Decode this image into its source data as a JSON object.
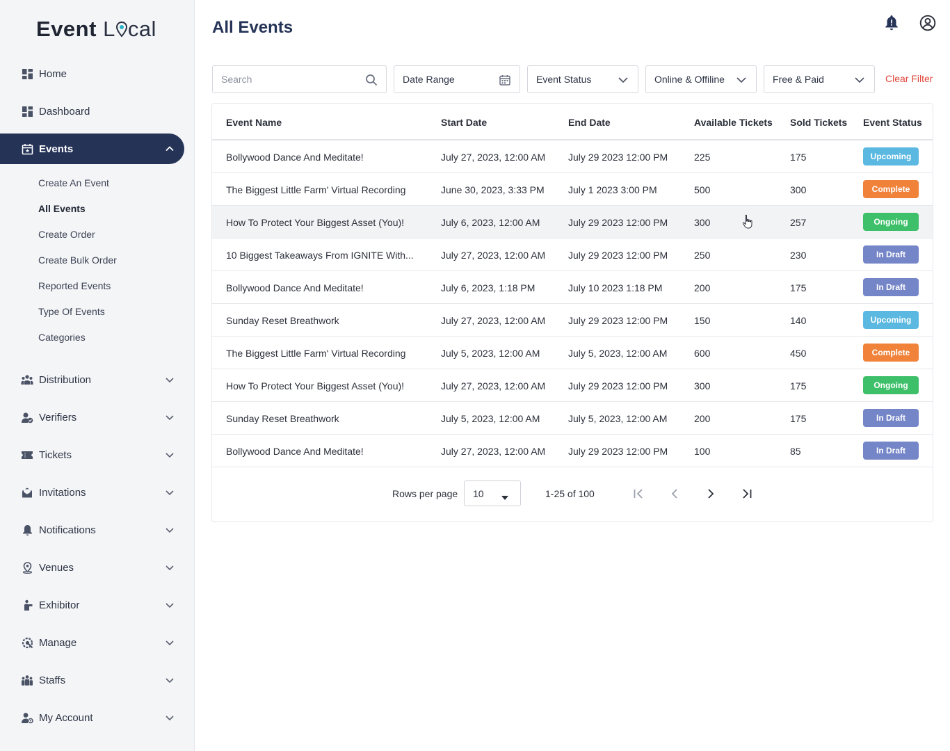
{
  "brand": {
    "part1": "E",
    "part2": "vent",
    "part3": "L",
    "part4": "cal"
  },
  "colors": {
    "accent": "#253357",
    "upcoming": "#5bb8e0",
    "complete": "#f0823a",
    "ongoing": "#3ec06a",
    "in_draft": "#7485c8",
    "danger": "#e0453a"
  },
  "sidebar": {
    "items": [
      {
        "label": "Home",
        "icon": "grid-icon"
      },
      {
        "label": "Dashboard",
        "icon": "grid-icon"
      },
      {
        "label": "Events",
        "icon": "calendar-icon"
      },
      {
        "label": "Distribution",
        "icon": "people-icon"
      },
      {
        "label": "Verifiers",
        "icon": "user-check-icon"
      },
      {
        "label": "Tickets",
        "icon": "ticket-icon"
      },
      {
        "label": "Invitations",
        "icon": "mail-icon"
      },
      {
        "label": "Notifications",
        "icon": "bell-icon"
      },
      {
        "label": "Venues",
        "icon": "location-icon"
      },
      {
        "label": "Exhibitor",
        "icon": "exhibitor-icon"
      },
      {
        "label": "Manage",
        "icon": "manage-icon"
      },
      {
        "label": "Staffs",
        "icon": "staff-icon"
      },
      {
        "label": "My Account",
        "icon": "account-icon"
      }
    ],
    "events_sub": [
      "Create An Event",
      "All Events",
      "Create Order",
      "Create Bulk Order",
      "Reported Events",
      "Type Of Events",
      "Categories"
    ]
  },
  "header": {
    "title": "All Events"
  },
  "filters": {
    "search_placeholder": "Search",
    "date_range": "Date Range",
    "event_status": "Event Status",
    "online_offline": "Online & Offiline",
    "free_paid": "Free & Paid",
    "clear": "Clear Filter"
  },
  "table": {
    "headers": [
      "Event Name",
      "Start Date",
      "End Date",
      "Available Tickets",
      "Sold Tickets",
      "Event Status"
    ],
    "rows": [
      {
        "name": "Bollywood Dance And Meditate!",
        "start": "July 27, 2023, 12:00 AM",
        "end": "July 29 2023 12:00 PM",
        "available": "225",
        "sold": "175",
        "status": "Upcoming",
        "status_key": "upcoming"
      },
      {
        "name": "The Biggest Little Farm' Virtual Recording",
        "start": "June 30, 2023, 3:33 PM",
        "end": "July 1 2023 3:00 PM",
        "available": "500",
        "sold": "300",
        "status": "Complete",
        "status_key": "complete"
      },
      {
        "name": "How To Protect Your Biggest Asset (You)!",
        "start": "July 6, 2023, 12:00 AM",
        "end": "July 29 2023 12:00 PM",
        "available": "300",
        "sold": "257",
        "status": "Ongoing",
        "status_key": "ongoing"
      },
      {
        "name": "10 Biggest Takeaways From IGNITE With...",
        "start": "July 27, 2023, 12:00 AM",
        "end": "July 29 2023 12:00 PM",
        "available": "250",
        "sold": "230",
        "status": "In Draft",
        "status_key": "in_draft"
      },
      {
        "name": "Bollywood Dance And Meditate!",
        "start": "July 6, 2023, 1:18 PM",
        "end": "July 10 2023 1:18 PM",
        "available": "200",
        "sold": "175",
        "status": "In Draft",
        "status_key": "in_draft"
      },
      {
        "name": "Sunday Reset Breathwork",
        "start": "July 27, 2023, 12:00 AM",
        "end": "July 29 2023 12:00 PM",
        "available": "150",
        "sold": "140",
        "status": "Upcoming",
        "status_key": "upcoming"
      },
      {
        "name": "The Biggest Little Farm' Virtual Recording",
        "start": "July 5, 2023, 12:00 AM",
        "end": "July 5, 2023, 12:00 AM",
        "available": "600",
        "sold": "450",
        "status": "Complete",
        "status_key": "complete"
      },
      {
        "name": "How To Protect Your Biggest Asset (You)!",
        "start": "July 27, 2023, 12:00 AM",
        "end": "July 29 2023 12:00 PM",
        "available": "300",
        "sold": "175",
        "status": "Ongoing",
        "status_key": "ongoing"
      },
      {
        "name": "Sunday Reset Breathwork",
        "start": "July 5, 2023, 12:00 AM",
        "end": "July 5, 2023, 12:00 AM",
        "available": "200",
        "sold": "175",
        "status": "In Draft",
        "status_key": "in_draft"
      },
      {
        "name": "Bollywood Dance And Meditate!",
        "start": "July 27, 2023, 12:00 AM",
        "end": "July 29 2023 12:00 PM",
        "available": "100",
        "sold": "85",
        "status": "In Draft",
        "status_key": "in_draft"
      }
    ]
  },
  "pagination": {
    "rows_label": "Rows per page",
    "rows_value": "10",
    "range": "1-25 of 100"
  }
}
